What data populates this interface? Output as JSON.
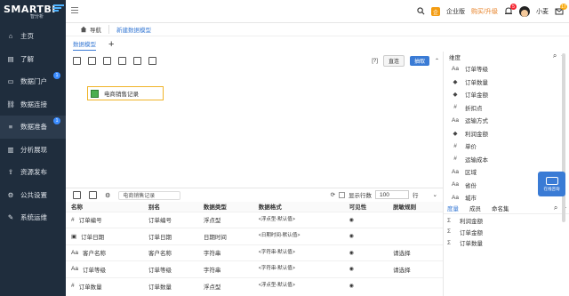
{
  "sidebar": {
    "logo": "SMARTBI",
    "logo_sub": "智分析",
    "items": [
      {
        "label": "主页",
        "icon": "home-icon",
        "badge": ""
      },
      {
        "label": "了解",
        "icon": "book-icon",
        "badge": ""
      },
      {
        "label": "数据门户",
        "icon": "monitor-icon",
        "badge": "1"
      },
      {
        "label": "数据连接",
        "icon": "link-icon",
        "badge": ""
      },
      {
        "label": "数据准备",
        "icon": "database-icon",
        "badge": "1"
      },
      {
        "label": "分析展现",
        "icon": "chart-icon",
        "badge": ""
      },
      {
        "label": "资源发布",
        "icon": "publish-icon",
        "badge": ""
      },
      {
        "label": "公共设置",
        "icon": "settings-icon",
        "badge": ""
      },
      {
        "label": "系统运维",
        "icon": "tools-icon",
        "badge": ""
      }
    ]
  },
  "topbar": {
    "edition": "企业版",
    "buy": "购买/升级",
    "bell_count": "5",
    "user": "小麦",
    "msg_count": "17"
  },
  "breadcrumb": {
    "home": "导航",
    "tab": "新建数据模型"
  },
  "tabs": {
    "active": "数据模型"
  },
  "toolbar": {
    "help": "[?]",
    "direct": "直连",
    "extract": "抽取"
  },
  "node": {
    "label": "电商销售记录"
  },
  "dimension_panel": {
    "title": "维度",
    "fields": [
      {
        "icon": "Aa",
        "name": "订单等级"
      },
      {
        "icon": "◆",
        "name": "订单数量"
      },
      {
        "icon": "◆",
        "name": "订单金额"
      },
      {
        "icon": "#",
        "name": "折扣点"
      },
      {
        "icon": "Aa",
        "name": "运输方式"
      },
      {
        "icon": "◆",
        "name": "利润金额"
      },
      {
        "icon": "#",
        "name": "单价"
      },
      {
        "icon": "#",
        "name": "运输成本"
      },
      {
        "icon": "Aa",
        "name": "区域"
      },
      {
        "icon": "Aa",
        "name": "省份"
      },
      {
        "icon": "Aa",
        "name": "城市"
      }
    ]
  },
  "measure_panel": {
    "tabs": [
      "度量",
      "成员",
      "命名集"
    ],
    "fields": [
      {
        "icon": "Σ",
        "name": "利润金额"
      },
      {
        "icon": "Σ",
        "name": "订单金额"
      },
      {
        "icon": "Σ",
        "name": "订单数量"
      }
    ]
  },
  "bottom": {
    "search_value": "电商销售记录",
    "show_rows_label": "显示行数",
    "rows": "100",
    "rows_unit": "行",
    "columns": [
      "名称",
      "别名",
      "数据类型",
      "数据格式",
      "可见性",
      "脱敏规则"
    ],
    "data": [
      {
        "icon": "#",
        "name": "订单编号",
        "alias": "订单编号",
        "type": "浮点型",
        "format": "<浮点型-默认值>",
        "mask": ""
      },
      {
        "icon": "▣",
        "name": "订单日期",
        "alias": "订单日期",
        "type": "日期时间",
        "format": "<日期时间-默认值>",
        "mask": ""
      },
      {
        "icon": "Aa",
        "name": "客户名称",
        "alias": "客户名称",
        "type": "字符串",
        "format": "<字符串-默认值>",
        "mask": "请选择"
      },
      {
        "icon": "Aa",
        "name": "订单等级",
        "alias": "订单等级",
        "type": "字符串",
        "format": "<字符串-默认值>",
        "mask": "请选择"
      },
      {
        "icon": "#",
        "name": "订单数量",
        "alias": "订单数量",
        "type": "浮点型",
        "format": "<浮点型-默认值>",
        "mask": ""
      }
    ]
  },
  "chat": {
    "label": "在线咨询"
  }
}
